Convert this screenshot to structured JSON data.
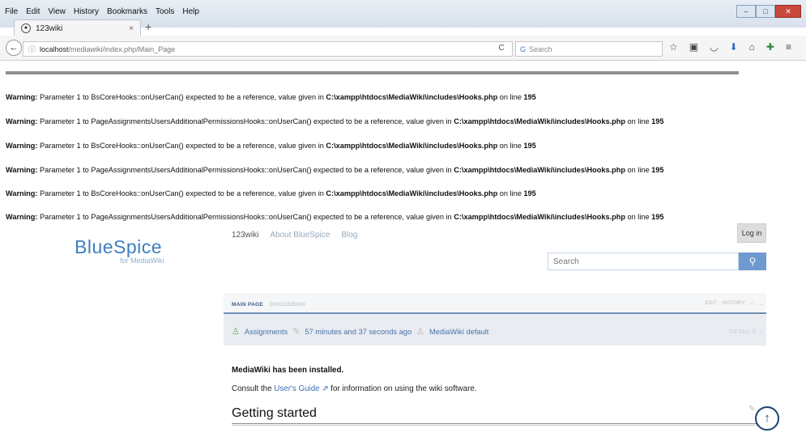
{
  "browser": {
    "menu": [
      "File",
      "Edit",
      "View",
      "History",
      "Bookmarks",
      "Tools",
      "Help"
    ],
    "window_controls": [
      "–",
      "□",
      "✕"
    ],
    "tab_title": "123wiki",
    "tab_close": "×",
    "new_tab": "+",
    "url_host": "localhost",
    "url_path": "/mediawiki/index.php/Main_Page",
    "search_placeholder": "Search",
    "reload": "C"
  },
  "warnings": {
    "prefix": "Warning:",
    "line_a_mid": " Parameter 1 to BsCoreHooks::onUserCan() expected to be a reference, value given in ",
    "line_b_mid": " Parameter 1 to PageAssignmentsUsersAdditionalPermissionsHooks::onUserCan() expected to be a reference, value given in ",
    "path": "C:\\xampp\\htdocs\\MediaWiki\\includes\\Hooks.php",
    "on_line": " on line ",
    "line_no": "195"
  },
  "wiki": {
    "logo_blue": "BlueSpice",
    "logo_sub": "for MediaWiki",
    "nav": [
      "123wiki",
      "About BlueSpice",
      "Blog"
    ],
    "login": "Log in",
    "search_placeholder": "Search",
    "tabs": [
      "MAIN PAGE",
      "DISCUSSION"
    ],
    "right_tabs": [
      "EDIT",
      "HISTORY"
    ],
    "meta": {
      "assignments": "Assignments",
      "time": "57 minutes and 37 seconds ago",
      "user": "MediaWiki default"
    },
    "details": "DETAILS",
    "installed": "MediaWiki has been installed.",
    "consult_pre": "Consult the ",
    "consult_link": "User's Guide",
    "consult_post": " for information on using the wiki software.",
    "heading": "Getting started"
  }
}
